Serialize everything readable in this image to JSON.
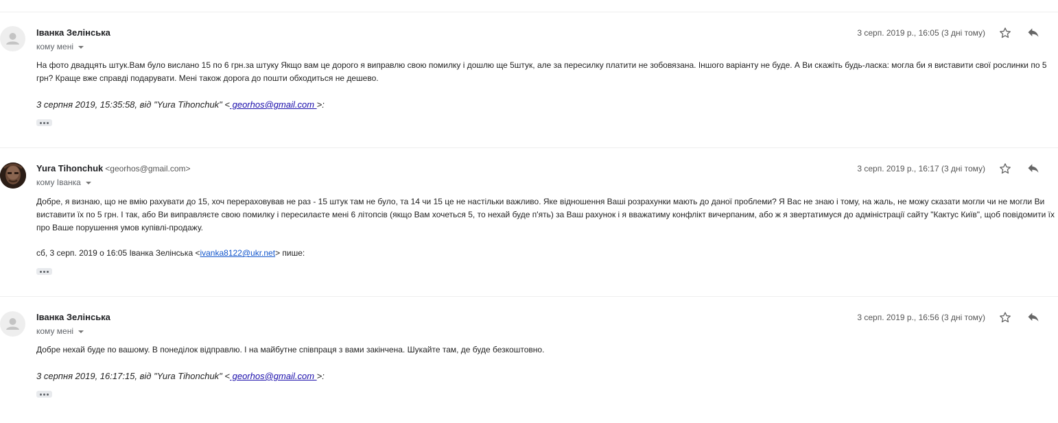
{
  "messages": [
    {
      "sender_name": "Іванка Зелінська",
      "sender_email": "",
      "to_label": "кому мені",
      "date": "3 серп. 2019 р., 16:05 (3 дні тому)",
      "body": "На фото двадцять штук.Вам було вислано 15 по 6 грн.за штуку Якщо вам це дорого я виправлю свою помилку і дошлю ще 5штук, але за пересилку платити не зобовязана. Іншого варіанту не буде. А Ви скажіть будь-ласка: могла би я виставити свої рослинки по 5 грн? Краще вже справді подарувати. Мені також дорога до пошти обходиться не дешево.",
      "quote_prefix": "3 серпня 2019, 15:35:58, від \"Yura Tihonchuk\" <",
      "quote_link": " georhos@gmail.com ",
      "quote_suffix": ">:"
    },
    {
      "sender_name": "Yura Tihonchuk",
      "sender_email": "<georhos@gmail.com>",
      "to_label": "кому Іванка",
      "date": "3 серп. 2019 р., 16:17 (3 дні тому)",
      "body": "Добре, я визнаю, що не вмію рахувати до 15, хоч перераховував не раз - 15 штук там не було, та 14 чи 15 це не настільки важливо. Яке відношення Ваші розрахунки мають до даної проблеми? Я Вас не знаю і тому, на жаль, не можу сказати могли чи не могли Ви виставити їх по 5 грн. І так, або Ви виправляєте свою помилку і пересилаєте мені 6 літопсів (якщо Вам хочеться 5, то нехай буде п'ять) за Ваш рахунок і я вважатиму конфлікт вичерпаним, або ж я звертатимуся до адміністрації сайту \"Кактус Київ\", щоб повідомити їх про Ваше порушення умов купівлі-продажу.",
      "quote_prefix": "сб, 3 серп. 2019 о 16:05 Іванка Зелінська <",
      "quote_link": "ivanka8122@ukr.net",
      "quote_suffix": "> пише:"
    },
    {
      "sender_name": "Іванка Зелінська",
      "sender_email": "",
      "to_label": "кому мені",
      "date": "3 серп. 2019 р., 16:56 (3 дні тому)",
      "body": "Добре нехай буде по вашому. В понеділок відправлю. І на майбутне співпраця з вами закінчена. Шукайте там, де буде безкоштовно.",
      "quote_prefix": "3 серпня 2019, 16:17:15, від \"Yura Tihonchuk\" <",
      "quote_link": " georhos@gmail.com ",
      "quote_suffix": ">:"
    }
  ],
  "icons": {
    "avatar": "person-icon",
    "star": "star-icon",
    "reply": "reply-icon",
    "more": "more-dots-icon"
  },
  "colors": {
    "link": "#1a0dab",
    "divider": "#eeeeee",
    "muted": "#555555"
  }
}
